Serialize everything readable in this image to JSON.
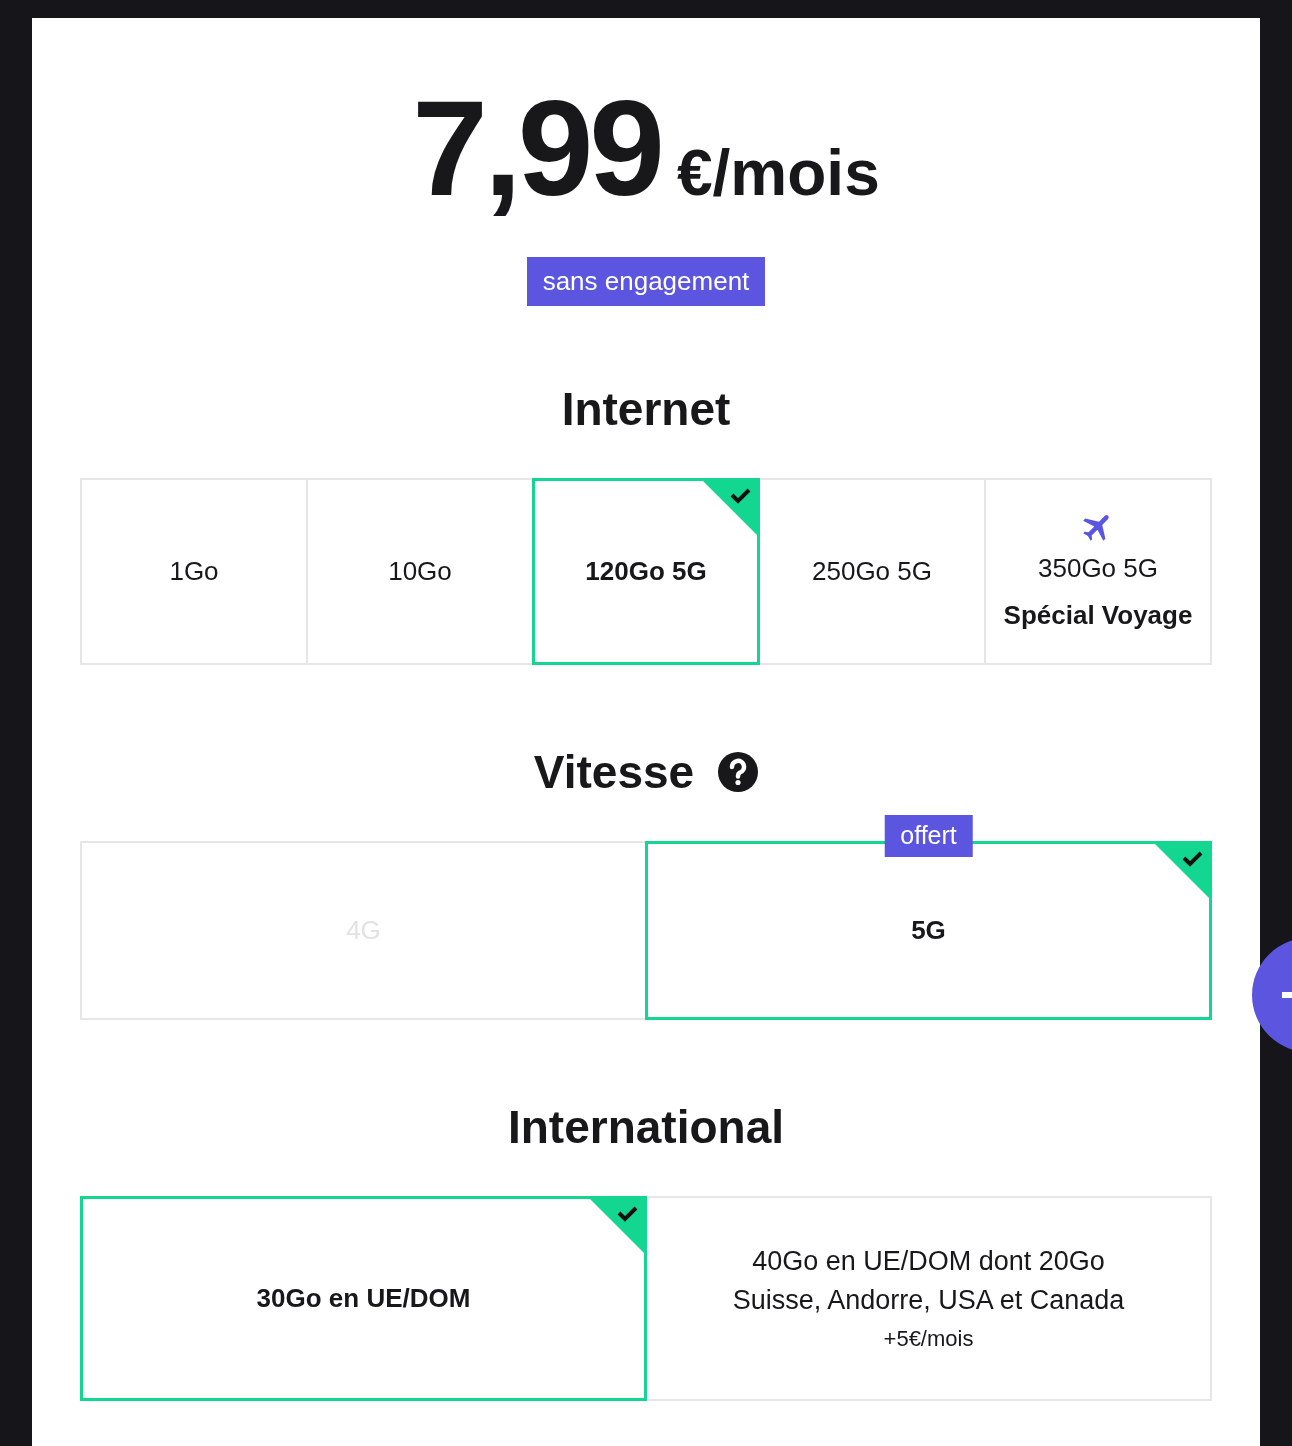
{
  "price": {
    "amount": "7,99",
    "unit": "€/mois"
  },
  "commitment_badge": "sans engagement",
  "sections": [
    {
      "title": "Internet",
      "help": false,
      "options": [
        {
          "kind": "plain",
          "label": "1Go",
          "selected": false,
          "disabled": false
        },
        {
          "kind": "plain",
          "label": "10Go",
          "selected": false,
          "disabled": false
        },
        {
          "kind": "plain",
          "label": "120Go 5G",
          "selected": true,
          "disabled": false
        },
        {
          "kind": "plain",
          "label": "250Go 5G",
          "selected": false,
          "disabled": false
        },
        {
          "kind": "travel",
          "label": "350Go 5G",
          "sublabel": "Spécial Voyage",
          "selected": false,
          "disabled": false
        }
      ]
    },
    {
      "title": "Vitesse",
      "help": true,
      "options": [
        {
          "kind": "plain",
          "label": "4G",
          "selected": false,
          "disabled": true
        },
        {
          "kind": "plain",
          "label": "5G",
          "selected": true,
          "disabled": false,
          "badge": "offert"
        }
      ]
    },
    {
      "title": "International",
      "help": false,
      "options": [
        {
          "kind": "plain",
          "label": "30Go en UE/DOM",
          "selected": true,
          "disabled": false
        },
        {
          "kind": "extra",
          "label": "40Go en UE/DOM dont 20Go Suisse, Andorre, USA et Canada",
          "extra_price": "+5€/mois",
          "selected": false,
          "disabled": false
        }
      ]
    }
  ]
}
